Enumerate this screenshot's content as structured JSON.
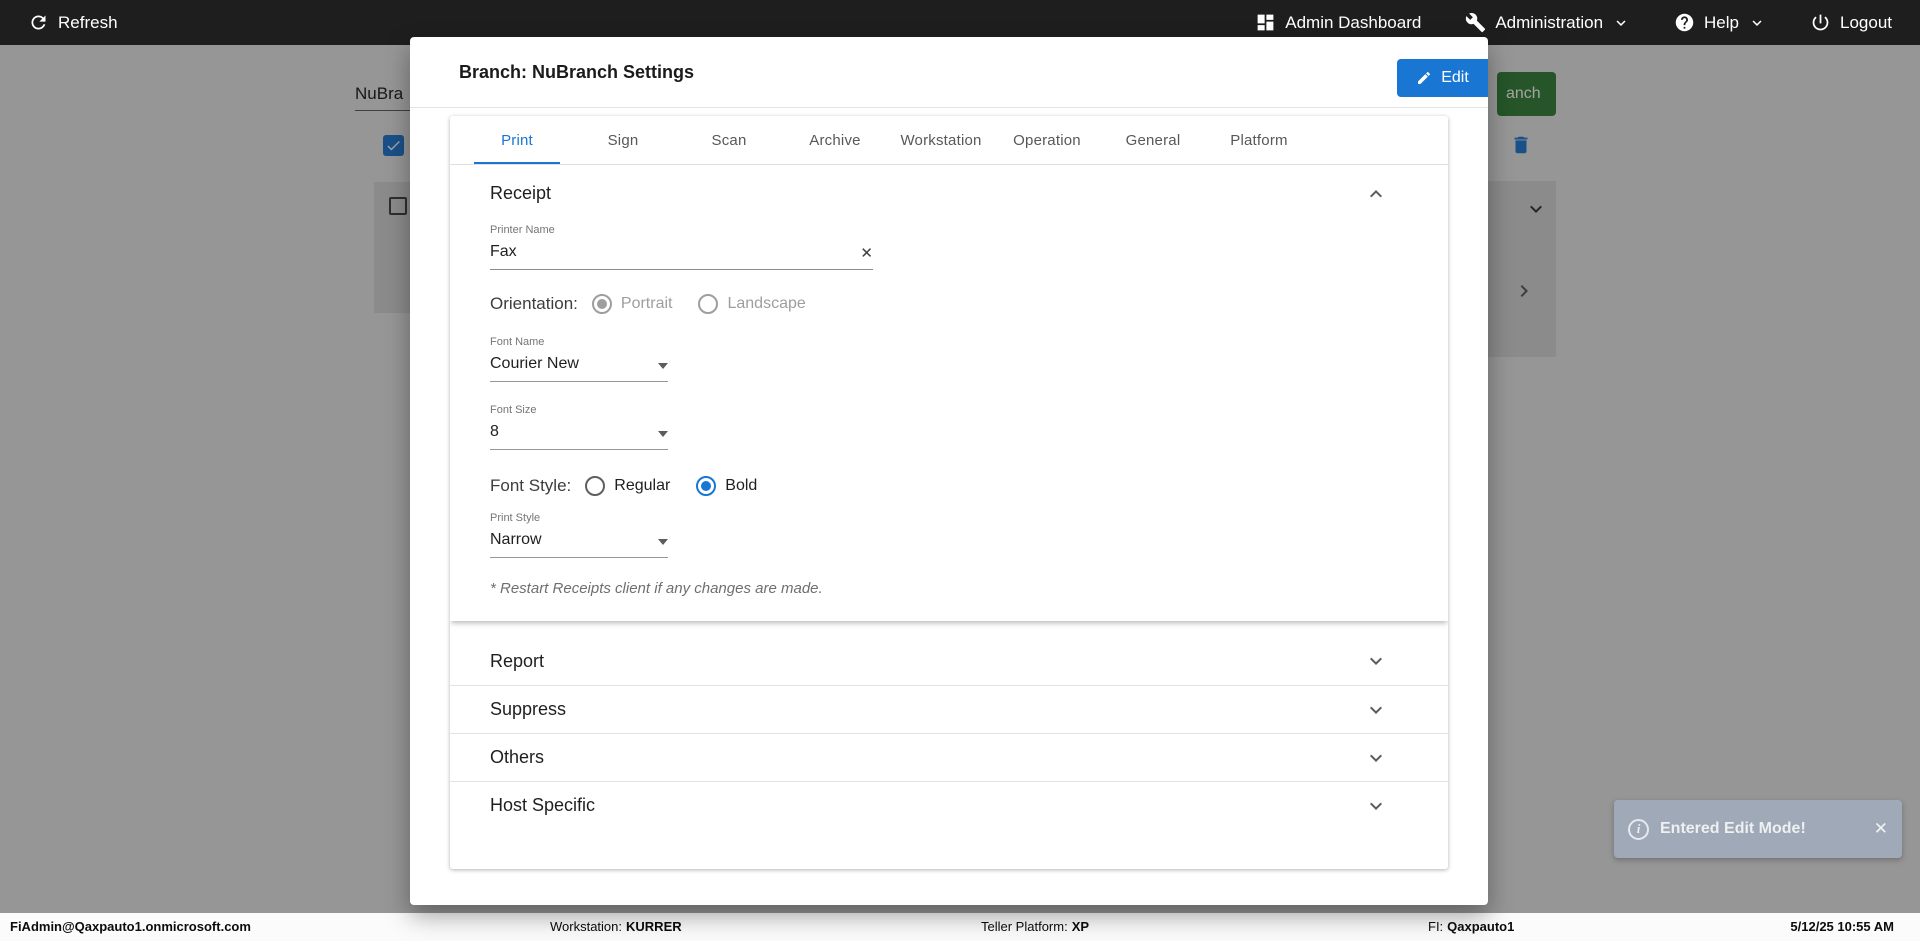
{
  "topbar": {
    "refresh": "Refresh",
    "admin_dashboard": "Admin Dashboard",
    "administration": "Administration",
    "help": "Help",
    "logout": "Logout"
  },
  "background": {
    "branch_field_value": "NuBra",
    "green_button_label": "anch"
  },
  "modal": {
    "title": "Branch: NuBranch Settings",
    "edit_button": "Edit",
    "tabs": [
      "Print",
      "Sign",
      "Scan",
      "Archive",
      "Workstation",
      "Operation",
      "General",
      "Platform"
    ],
    "active_tab": "Print",
    "receipt": {
      "title": "Receipt",
      "printer_name_label": "Printer Name",
      "printer_name_value": "Fax",
      "orientation_label": "Orientation:",
      "orientation_options": [
        "Portrait",
        "Landscape"
      ],
      "orientation_selected": "Portrait",
      "font_name_label": "Font Name",
      "font_name_value": "Courier New",
      "font_size_label": "Font Size",
      "font_size_value": "8",
      "font_style_label": "Font Style:",
      "font_style_options": [
        "Regular",
        "Bold"
      ],
      "font_style_selected": "Bold",
      "print_style_label": "Print Style",
      "print_style_value": "Narrow",
      "note": "* Restart Receipts client if any changes are made."
    },
    "sections": [
      "Report",
      "Suppress",
      "Others",
      "Host Specific"
    ]
  },
  "toast": {
    "message": "Entered Edit Mode!"
  },
  "footer": {
    "user": "FiAdmin@Qaxpauto1.onmicrosoft.com",
    "workstation_label": "Workstation:",
    "workstation_value": "KURRER",
    "teller_label": "Teller Platform:",
    "teller_value": "XP",
    "fi_label": "FI:",
    "fi_value": "Qaxpauto1",
    "datetime": "5/12/25 10:55 AM"
  },
  "colors": {
    "accent": "#1976d2",
    "topbar": "#1e1e1e",
    "green_button": "#2e7d32"
  }
}
